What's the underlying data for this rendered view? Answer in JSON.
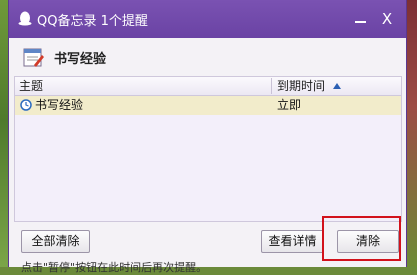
{
  "window": {
    "title": "QQ备忘录 1个提醒",
    "app_icon": "qq-penguin-icon",
    "minimize_label": "_",
    "close_label": "X"
  },
  "header": {
    "icon": "memo-icon",
    "title": "书写经验"
  },
  "table": {
    "columns": [
      "主题",
      "到期时间"
    ],
    "sort_icon": "sort-ascending-icon",
    "rows": [
      {
        "icon": "clock-icon",
        "subject": "书写经验",
        "due": "立即"
      }
    ]
  },
  "buttons": {
    "clear_all": "全部清除",
    "view_details": "查看详情",
    "clear": "清除"
  },
  "footer": {
    "hint": "点击\"暂停\"按钮在此时间后再次提醒。"
  },
  "colors": {
    "titlebar": "#6a43a4",
    "selected_row": "#f2eccb",
    "highlight": "#d2121b"
  }
}
